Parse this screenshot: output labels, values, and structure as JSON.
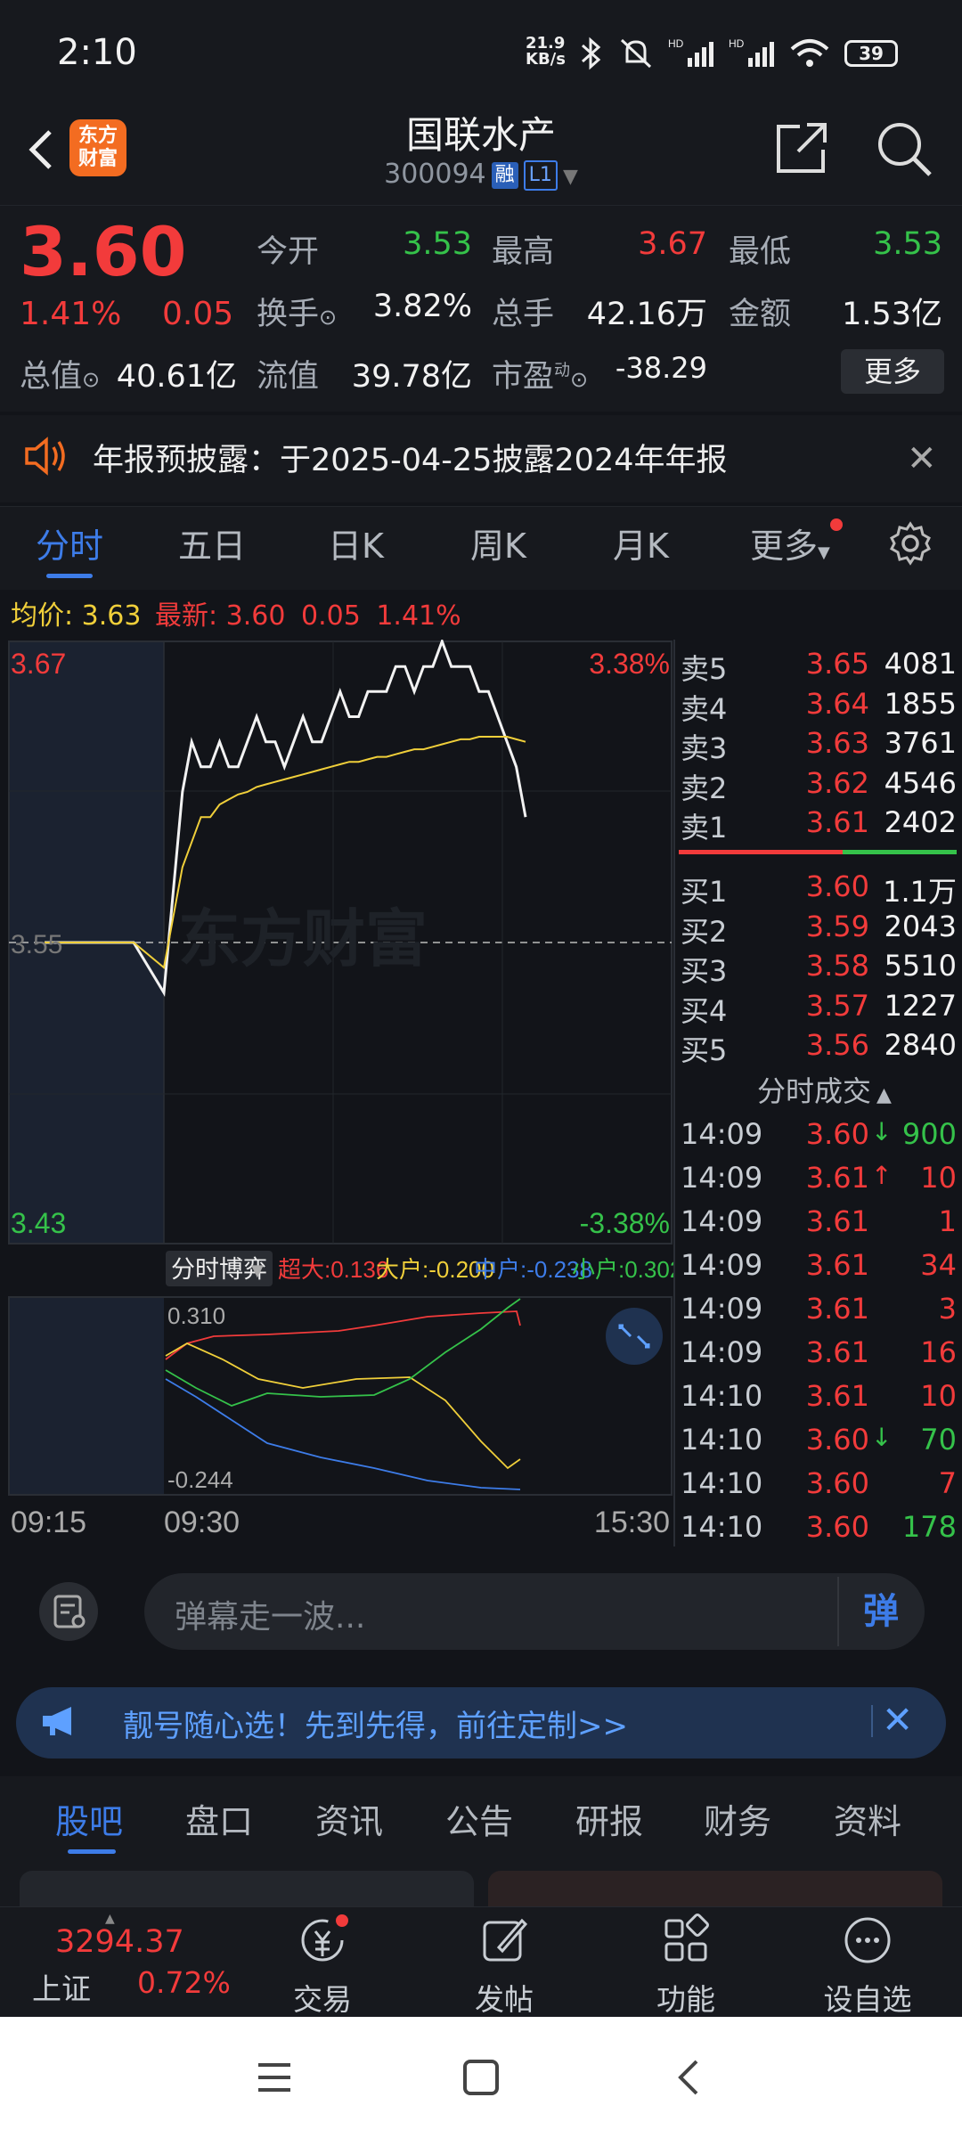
{
  "status": {
    "time": "2:10",
    "net_speed_top": "21.9",
    "net_speed_unit": "KB/s",
    "battery": "39"
  },
  "header": {
    "logo_line1": "东方",
    "logo_line2": "财富",
    "title": "国联水产",
    "code": "300094",
    "tag_rong": "融",
    "tag_level": "L1"
  },
  "quote": {
    "price": "3.60",
    "pct": "1.41%",
    "change": "0.05",
    "rows": [
      {
        "label": "今开",
        "value": "3.53",
        "color": "green"
      },
      {
        "label": "最高",
        "value": "3.67",
        "color": "red"
      },
      {
        "label": "最低",
        "value": "3.53",
        "color": "green"
      },
      {
        "label": "换手",
        "value": "3.82%",
        "color": "white"
      },
      {
        "label": "总手",
        "value": "42.16万",
        "color": "white"
      },
      {
        "label": "金额",
        "value": "1.53亿",
        "color": "white"
      },
      {
        "label": "总值",
        "value": "40.61亿",
        "color": "white"
      },
      {
        "label": "流值",
        "value": "39.78亿",
        "color": "white"
      },
      {
        "label": "市盈",
        "value": "-38.29",
        "color": "white"
      }
    ],
    "pe_superscript": "动",
    "more_label": "更多"
  },
  "notice": {
    "text": "年报预披露：于2025-04-25披露2024年年报"
  },
  "tabs": [
    "分时",
    "五日",
    "日K",
    "周K",
    "月K",
    "更多"
  ],
  "infoline": {
    "avg_label": "均价:",
    "avg_value": "3.63",
    "last_label": "最新:",
    "last_value": "3.60",
    "change": "0.05",
    "pct": "1.41%"
  },
  "chart": {
    "y_top": "3.67",
    "y_mid": "3.55",
    "y_bottom": "3.43",
    "pct_top": "3.38%",
    "pct_bottom": "-3.38%",
    "watermark": "东方财富",
    "flow_selector": "分时博弈",
    "flow_legend": [
      {
        "label": "超大:0.136",
        "color": "#f23b3b"
      },
      {
        "label": "大户:-0.200",
        "color": "#f0cf3a"
      },
      {
        "label": "中户:-0.238",
        "color": "#3d7ce8"
      },
      {
        "label": "小户:0.302",
        "color": "#35c24a"
      }
    ],
    "flow_max": "0.310",
    "flow_min": "-0.244",
    "time_start": "09:15",
    "time_open": "09:30",
    "time_end": "15:30"
  },
  "chart_data": {
    "type": "line",
    "title": "",
    "xlabel": "",
    "ylabel": "",
    "ylim": [
      3.43,
      3.67
    ],
    "x": [
      "09:15",
      "09:25",
      "09:30",
      "09:35",
      "09:40",
      "09:45",
      "09:50",
      "09:55",
      "10:00",
      "10:05",
      "10:10",
      "10:15",
      "10:20",
      "10:25",
      "10:30",
      "10:35",
      "10:40",
      "10:45",
      "10:50",
      "10:55",
      "11:00",
      "11:05",
      "11:10",
      "11:15",
      "11:20",
      "11:25",
      "11:30",
      "13:00",
      "13:05",
      "13:10",
      "13:15",
      "13:20",
      "13:25",
      "13:30",
      "13:35",
      "13:40",
      "13:45",
      "13:50",
      "13:55",
      "14:00",
      "14:05",
      "14:10"
    ],
    "series": [
      {
        "name": "最新",
        "values": [
          3.55,
          3.55,
          3.53,
          3.57,
          3.61,
          3.63,
          3.62,
          3.62,
          3.63,
          3.62,
          3.62,
          3.63,
          3.64,
          3.63,
          3.63,
          3.62,
          3.63,
          3.64,
          3.63,
          3.63,
          3.64,
          3.65,
          3.64,
          3.64,
          3.65,
          3.65,
          3.65,
          3.66,
          3.66,
          3.65,
          3.66,
          3.66,
          3.67,
          3.66,
          3.66,
          3.66,
          3.65,
          3.65,
          3.64,
          3.63,
          3.62,
          3.6
        ]
      },
      {
        "name": "均价",
        "values": [
          3.55,
          3.55,
          3.54,
          3.56,
          3.58,
          3.59,
          3.6,
          3.6,
          3.605,
          3.607,
          3.609,
          3.61,
          3.612,
          3.613,
          3.614,
          3.615,
          3.616,
          3.617,
          3.618,
          3.619,
          3.62,
          3.621,
          3.622,
          3.622,
          3.623,
          3.624,
          3.624,
          3.625,
          3.626,
          3.627,
          3.627,
          3.628,
          3.629,
          3.63,
          3.631,
          3.631,
          3.632,
          3.632,
          3.632,
          3.632,
          3.631,
          3.63
        ]
      }
    ]
  },
  "orderbook": {
    "sells": [
      {
        "label": "卖5",
        "price": "3.65",
        "vol": "4081"
      },
      {
        "label": "卖4",
        "price": "3.64",
        "vol": "1855"
      },
      {
        "label": "卖3",
        "price": "3.63",
        "vol": "3761"
      },
      {
        "label": "卖2",
        "price": "3.62",
        "vol": "4546"
      },
      {
        "label": "卖1",
        "price": "3.61",
        "vol": "2402"
      }
    ],
    "buys": [
      {
        "label": "买1",
        "price": "3.60",
        "vol": "1.1万"
      },
      {
        "label": "买2",
        "price": "3.59",
        "vol": "2043"
      },
      {
        "label": "买3",
        "price": "3.58",
        "vol": "5510"
      },
      {
        "label": "买4",
        "price": "3.57",
        "vol": "1227"
      },
      {
        "label": "买5",
        "price": "3.56",
        "vol": "2840"
      }
    ],
    "trades_title": "分时成交",
    "trades": [
      {
        "time": "14:09",
        "price": "3.60",
        "arrow": "↓",
        "vol": "900",
        "vcolor": "green"
      },
      {
        "time": "14:09",
        "price": "3.61",
        "arrow": "↑",
        "vol": "10",
        "vcolor": "red"
      },
      {
        "time": "14:09",
        "price": "3.61",
        "arrow": "",
        "vol": "1",
        "vcolor": "red"
      },
      {
        "time": "14:09",
        "price": "3.61",
        "arrow": "",
        "vol": "34",
        "vcolor": "red"
      },
      {
        "time": "14:09",
        "price": "3.61",
        "arrow": "",
        "vol": "3",
        "vcolor": "red"
      },
      {
        "time": "14:09",
        "price": "3.61",
        "arrow": "",
        "vol": "16",
        "vcolor": "red"
      },
      {
        "time": "14:10",
        "price": "3.61",
        "arrow": "",
        "vol": "10",
        "vcolor": "red"
      },
      {
        "time": "14:10",
        "price": "3.60",
        "arrow": "↓",
        "vol": "70",
        "vcolor": "green"
      },
      {
        "time": "14:10",
        "price": "3.60",
        "arrow": "",
        "vol": "7",
        "vcolor": "red"
      },
      {
        "time": "14:10",
        "price": "3.60",
        "arrow": "",
        "vol": "178",
        "vcolor": "green"
      }
    ]
  },
  "danmu": {
    "placeholder": "弹幕走一波...",
    "button": "弹"
  },
  "promo": {
    "text": "靓号随心选！先到先得，前往定制>>"
  },
  "subtabs": [
    "股吧",
    "盘口",
    "资讯",
    "公告",
    "研报",
    "财务",
    "资料"
  ],
  "bottom": {
    "index_value": "3294.37",
    "index_name": "上证",
    "index_pct": "0.72%",
    "nav": [
      "交易",
      "发帖",
      "功能",
      "设自选"
    ]
  }
}
